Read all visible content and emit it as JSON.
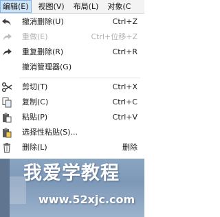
{
  "menubar": {
    "items": [
      {
        "label": "编辑(E)",
        "active": true
      },
      {
        "label": "视图(V)",
        "active": false
      },
      {
        "label": "布局(L)",
        "active": false
      },
      {
        "label": "对象(C",
        "active": false
      }
    ]
  },
  "menu": {
    "items": [
      {
        "label": "撤消删除(U)",
        "shortcut": "Ctrl+Z",
        "icon": "undo-icon",
        "enabled": true
      },
      {
        "label": "重做(E)",
        "shortcut": "Ctrl+位移+Z",
        "icon": "redo-icon",
        "enabled": false
      },
      {
        "label": "重复删除(R)",
        "shortcut": "Ctrl+R",
        "icon": "repeat-icon",
        "enabled": true
      },
      {
        "label": "撤消管理器(G)",
        "shortcut": "",
        "icon": "",
        "enabled": true
      },
      {
        "label": "剪切(T)",
        "shortcut": "Ctrl+X",
        "icon": "scissors-icon",
        "enabled": true
      },
      {
        "label": "复制(C)",
        "shortcut": "Ctrl+C",
        "icon": "copy-icon",
        "enabled": true
      },
      {
        "label": "粘贴(P)",
        "shortcut": "Ctrl+V",
        "icon": "paste-icon",
        "enabled": true
      },
      {
        "label": "选择性粘贴(S)...",
        "shortcut": "",
        "icon": "paste-special-icon",
        "enabled": true
      },
      {
        "label": "删除(L)",
        "shortcut": "删除",
        "icon": "trash-icon",
        "enabled": true
      }
    ]
  },
  "banner": {
    "title": "我爱学教程",
    "url": "www.52xjc.com"
  },
  "colors": {
    "menubar_active_bg": "#cfe3f7",
    "menubar_active_border": "#7eb4ea",
    "disabled_text": "#b4b4b4",
    "banner_bg": "#8aa5c2"
  }
}
